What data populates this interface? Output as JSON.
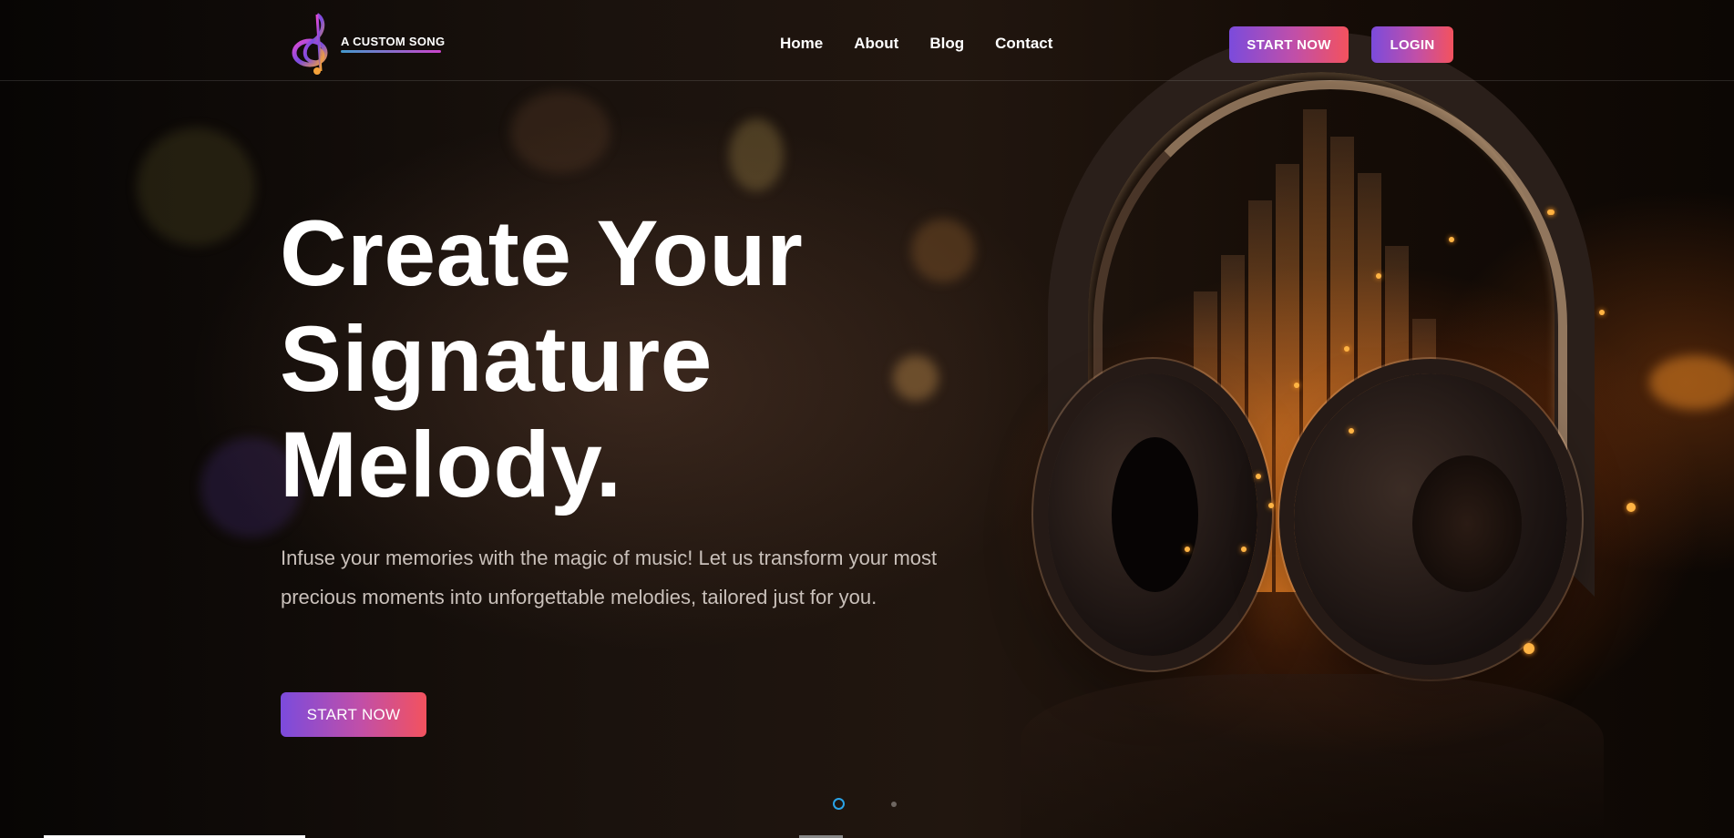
{
  "brand": {
    "name": "A CUSTOM SONG",
    "logo_icon": "treble-clef-icon",
    "colors": {
      "gradient_start": "#7b4bdc",
      "gradient_mid": "#c14fa8",
      "gradient_end": "#f3525e",
      "slider_active": "#2aa3e6"
    }
  },
  "nav": {
    "items": [
      {
        "label": "Home"
      },
      {
        "label": "About"
      },
      {
        "label": "Blog"
      },
      {
        "label": "Contact"
      }
    ]
  },
  "header_actions": {
    "start_label": "START NOW",
    "login_label": "LOGIN"
  },
  "hero": {
    "title_lines": [
      "Create Your",
      "Signature",
      "Melody."
    ],
    "subtitle": "Infuse your memories with the magic of music! Let us transform your most precious moments into unforgettable melodies, tailored just for you.",
    "cta_label": "START NOW",
    "image_icon": "headphones-image"
  },
  "slider": {
    "slide_count": 2,
    "active_index": 0
  }
}
